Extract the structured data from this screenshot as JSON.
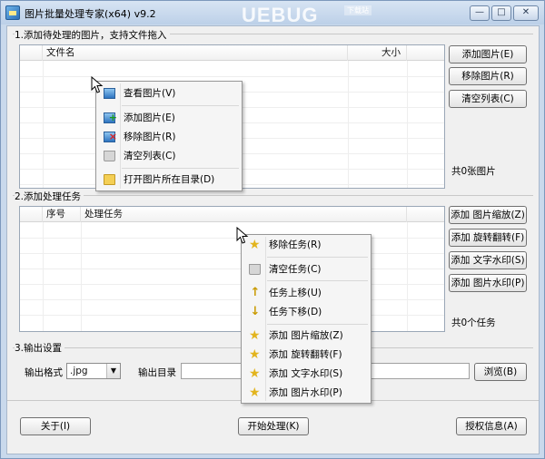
{
  "window": {
    "title": "图片批量处理专家(x64) v9.2",
    "watermark": "UEBUG",
    "watermark_sub": "下载站",
    "minimize_glyph": "—",
    "maximize_glyph": "□",
    "close_glyph": "✕"
  },
  "section1": {
    "label": "1.添加待处理的图片，支持文件拖入",
    "columns": [
      "文件名",
      "大小"
    ],
    "buttons": [
      "添加图片(E)",
      "移除图片(R)",
      "清空列表(C)"
    ],
    "count": "共0张图片"
  },
  "section2": {
    "label": "2.添加处理任务",
    "columns": [
      "序号",
      "处理任务"
    ],
    "buttons": [
      "添加 图片缩放(Z)",
      "添加 旋转翻转(F)",
      "添加 文字水印(S)",
      "添加 图片水印(P)"
    ],
    "count": "共0个任务"
  },
  "section3": {
    "label": "3.输出设置",
    "format_label": "输出格式",
    "format_value": ".jpg",
    "dir_label": "输出目录",
    "dir_value": "",
    "browse": "浏览(B)"
  },
  "footer": {
    "about": "关于(I)",
    "start": "开始处理(K)",
    "license": "授权信息(A)"
  },
  "menu1": {
    "items": [
      "查看图片(V)",
      "添加图片(E)",
      "移除图片(R)",
      "清空列表(C)",
      "打开图片所在目录(D)"
    ]
  },
  "menu2": {
    "items": [
      "移除任务(R)",
      "清空任务(C)",
      "任务上移(U)",
      "任务下移(D)",
      "添加 图片缩放(Z)",
      "添加 旋转翻转(F)",
      "添加 文字水印(S)",
      "添加 图片水印(P)"
    ]
  },
  "icons": {
    "dropdown_arrow": "▼",
    "arrow_up": "↑",
    "arrow_down": "↓",
    "star": "★",
    "trash_color": "#d6d6d6",
    "folder_color": "#f4cf55"
  }
}
